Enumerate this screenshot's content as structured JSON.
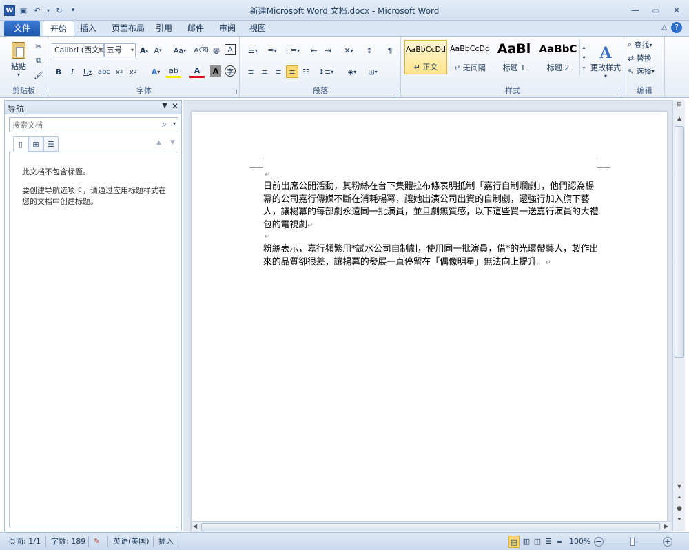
{
  "window": {
    "title": "新建Microsoft Word 文档.docx - Microsoft Word",
    "app_icon": "W"
  },
  "qat": {
    "save": "save-icon",
    "undo": "undo-icon",
    "redo": "redo-icon",
    "customize": "customize-icon"
  },
  "tabs": {
    "file": "文件",
    "items": [
      "开始",
      "插入",
      "页面布局",
      "引用",
      "邮件",
      "审阅",
      "视图"
    ],
    "active": "开始"
  },
  "ribbon": {
    "clipboard": {
      "label": "剪贴板",
      "paste": "粘贴"
    },
    "font": {
      "label": "字体",
      "family": "Calibri (西文‡",
      "size": "五号",
      "case": "Aa"
    },
    "paragraph": {
      "label": "段落"
    },
    "styles": {
      "label": "样式",
      "tiles": [
        {
          "sample": "AaBbCcDd",
          "name": "↵ 正文"
        },
        {
          "sample": "AaBbCcDd",
          "name": "↵ 无间隔"
        },
        {
          "sample": "AaBl",
          "name": "标题 1"
        },
        {
          "sample": "AaBbC",
          "name": "标题 2"
        }
      ],
      "change": "更改样式"
    },
    "editing": {
      "label": "编辑",
      "find": "查找",
      "replace": "替换",
      "select": "选择"
    }
  },
  "nav": {
    "title": "导航",
    "search_placeholder": "搜索文档",
    "msg1": "此文档不包含标题。",
    "msg2": "要创建导航选项卡，请通过应用标题样式在您的文档中创建标题。"
  },
  "doc": {
    "para1": "日前出席公開活動，其粉絲在台下集體拉布條表明抵制「嘉行自制爛劇」，他們認為楊冪的公司嘉行傳媒不斷在消耗楊冪，讓她出演公司出資的自制劇，還強行加入旗下藝人，讓楊冪的每部劇永遠同一批演員，並且劇無質感，以下這些買一送嘉行演員的大禮包的電視劇",
    "para2": "粉絲表示，嘉行頻繁用*試水公司自制劇，使用同一批演員，借*的光環帶藝人，製作出來的品質卻很差，讓楊冪的發展一直停留在「偶像明星」無法向上提升。",
    "mark": "↵"
  },
  "status": {
    "page": "页面: 1/1",
    "words": "字数: 189",
    "lang": "英语(美国)",
    "mode": "插入",
    "zoom": "100%"
  }
}
